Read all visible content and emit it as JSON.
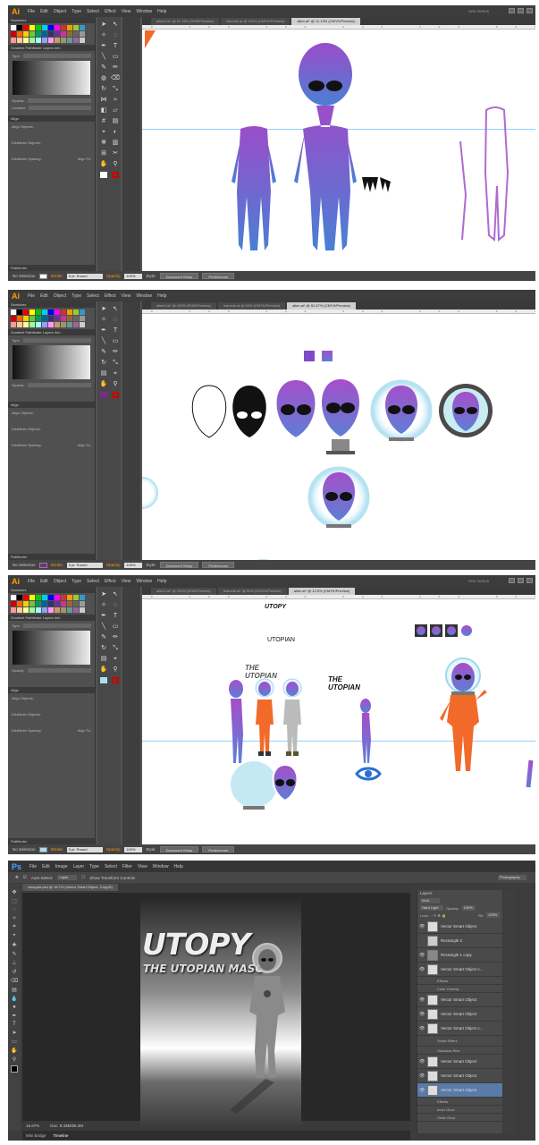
{
  "illustrator": {
    "menu": [
      "File",
      "Edit",
      "Object",
      "Type",
      "Select",
      "Effect",
      "View",
      "Window",
      "Help"
    ],
    "workspace": "new menus",
    "panels": {
      "swatches": "Swatches",
      "gradient_tabs": "Gradient  Pathfinder  Layers  Info",
      "type_label": "Type:",
      "opacity": "Opacity:",
      "location": "Location:",
      "align": "Align",
      "align_objects": "Align Objects:",
      "distribute_objects": "Distribute Objects:",
      "distribute_spacing": "Distribute Spacing:",
      "align_to": "Align To:",
      "pathfinder": "Pathfinder",
      "stroke": "Stroke:",
      "uniform": "5 pt. Round",
      "opacity_bar": "Opacity:",
      "opacity_val": "100%",
      "style": "Style:",
      "doc_setup": "Document Setup",
      "preferences": "Preferences",
      "no_selection": "No Selection",
      "selection": "Selection"
    },
    "screens": [
      {
        "tabs": [
          "alien2.ai* @ 11.13% (RGB/Preview)",
          "marcele.ai @ 100% (CMYK/Preview)",
          "alien.ai* @ 11.13% (CMYK/Preview)"
        ],
        "zoom": "11.13%"
      },
      {
        "tabs": [
          "alien2.ai* @ 100% (RGB/Preview)",
          "marcele.ai @ 50% (CMYK/Preview)",
          "alien.ai* @ 51.67% (CMYK/Preview)"
        ],
        "zoom": "51.67%"
      },
      {
        "tabs": [
          "alien2.ai* @ 100% (RGB/Preview)",
          "marcele.ai* @ 50% (CMYK/Preview)",
          "alien.ai* @ 12.5% (CMYK/Preview)"
        ],
        "zoom": "12.5%"
      }
    ],
    "canvas3": {
      "utopy_small": "UTOPY",
      "utopian": "UTOPIAN",
      "the_utopian_left": "THE UTOPIAN",
      "the_utopian_right": "THE UTOPIAN"
    }
  },
  "photoshop": {
    "menu": [
      "File",
      "Edit",
      "Image",
      "Layer",
      "Type",
      "Select",
      "Filter",
      "View",
      "Window",
      "Help"
    ],
    "options": {
      "auto_select": "Auto-Select:",
      "layer": "Layer",
      "transform": "Show Transform Controls",
      "workspace": "Photography"
    },
    "doc_tab": "whopper.psd @ 16.7% (Vector Smart Object, Copy/8)",
    "poster": {
      "title": "UTOPY",
      "subtitle": "THE UTOPIAN MASC"
    },
    "status": {
      "zoom": "16.67%",
      "doc": "Doc: 8.33M/96.2M"
    },
    "bottom_tabs": [
      "Mini Bridge",
      "Timeline"
    ],
    "layers_panel": {
      "tab": "Layers",
      "kind": "Kind",
      "blend": "Hard Light",
      "opacity_label": "Opacity:",
      "opacity": "100%",
      "lock": "Lock:",
      "fill_label": "Fill:",
      "fill": "100%"
    },
    "layers": [
      {
        "name": "Vector Smart Object",
        "type": "layer"
      },
      {
        "name": "Rectangle 2",
        "type": "layer"
      },
      {
        "name": "Rectangle 1 copy",
        "type": "layer"
      },
      {
        "name": "Vector Smart Object c...",
        "type": "layer"
      },
      {
        "name": "Effects",
        "type": "sub"
      },
      {
        "name": "Color Overlay",
        "type": "sub"
      },
      {
        "name": "Vector Smart Object",
        "type": "layer"
      },
      {
        "name": "Vector Smart Object",
        "type": "layer"
      },
      {
        "name": "Vector Smart Object c...",
        "type": "layer"
      },
      {
        "name": "Smart Filters",
        "type": "sub"
      },
      {
        "name": "Gaussian Blur",
        "type": "sub"
      },
      {
        "name": "Vector Smart Object",
        "type": "layer"
      },
      {
        "name": "Vector Smart Object",
        "type": "layer"
      },
      {
        "name": "Vector Smart Object",
        "type": "layer"
      },
      {
        "name": "Effects",
        "type": "sub"
      },
      {
        "name": "Inner Glow",
        "type": "sub"
      },
      {
        "name": "Outer Glow",
        "type": "sub"
      }
    ]
  }
}
